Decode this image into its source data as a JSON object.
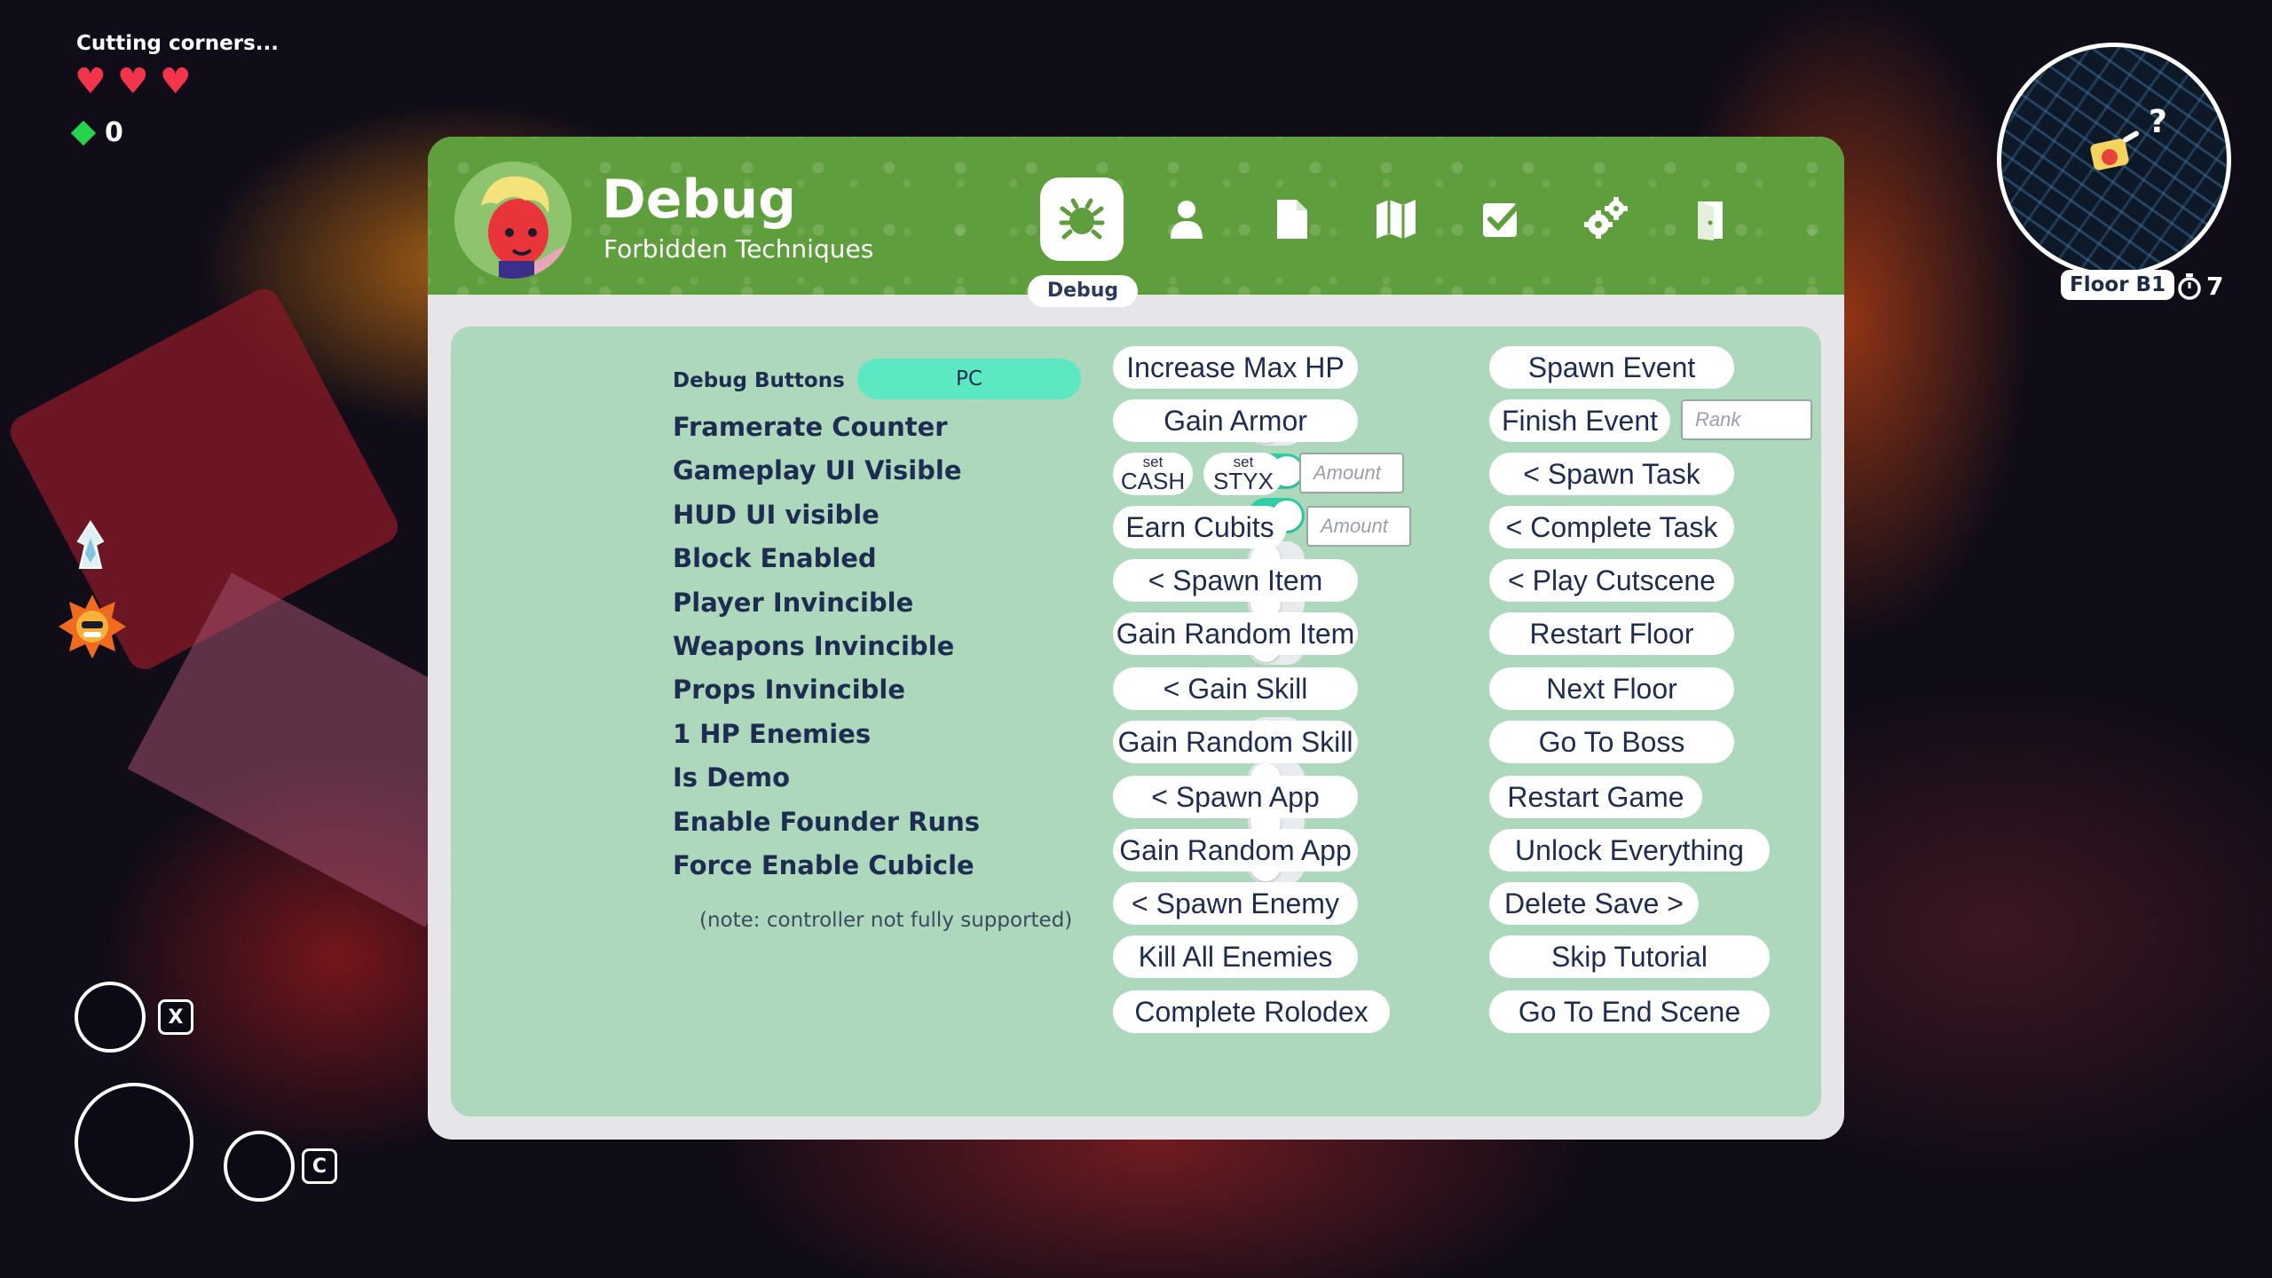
{
  "hud": {
    "status_text": "Cutting corners...",
    "hearts": 3,
    "gem_count": "0",
    "key_x": "X",
    "key_c": "C",
    "floor_label": "Floor B1",
    "timer_value": "7",
    "minimap_marker": "?"
  },
  "panel": {
    "title": "Debug",
    "subtitle": "Forbidden Techniques",
    "active_tab_label": "Debug",
    "tabs": [
      {
        "icon": "bug-icon",
        "active": true
      },
      {
        "icon": "person-icon",
        "active": false
      },
      {
        "icon": "document-icon",
        "active": false
      },
      {
        "icon": "map-icon",
        "active": false
      },
      {
        "icon": "checkbox-icon",
        "active": false
      },
      {
        "icon": "gears-icon",
        "active": false
      },
      {
        "icon": "exit-door-icon",
        "active": false
      }
    ]
  },
  "debug_buttons": {
    "label": "Debug Buttons",
    "mode": "PC"
  },
  "toggles": [
    {
      "label": "Framerate Counter",
      "on": false
    },
    {
      "label": "Gameplay UI Visible",
      "on": true
    },
    {
      "label": "HUD UI visible",
      "on": true
    },
    {
      "label": "Block Enabled",
      "on": false
    },
    {
      "label": "Player Invincible",
      "on": false
    },
    {
      "label": "Weapons Invincible",
      "on": false
    },
    {
      "label": "Props Invincible",
      "on": false
    },
    {
      "label": "1 HP Enemies",
      "on": false
    },
    {
      "label": "Is Demo",
      "on": false
    },
    {
      "label": "Enable Founder Runs",
      "on": false
    },
    {
      "label": "Force Enable Cubicle",
      "on": false
    }
  ],
  "note": "(note: controller not fully supported)",
  "col1": {
    "increase_max_hp": "Increase Max HP",
    "gain_armor": "Gain Armor",
    "set_cash_small": "set",
    "set_cash_big": "CASH",
    "set_styx_small": "set",
    "set_styx_big": "STYX",
    "amount_placeholder": "Amount",
    "earn_cubits": "Earn Cubits",
    "spawn_item": "< Spawn Item",
    "gain_random_item": "Gain Random Item",
    "gain_skill": "< Gain Skill",
    "gain_random_skill": "Gain Random Skill",
    "spawn_app": "< Spawn App",
    "gain_random_app": "Gain Random App",
    "spawn_enemy": "< Spawn Enemy",
    "kill_all_enemies": "Kill All Enemies",
    "complete_rolodex": "Complete Rolodex"
  },
  "col2": {
    "spawn_event": "Spawn Event",
    "finish_event": "Finish Event",
    "rank_placeholder": "Rank",
    "spawn_task": "< Spawn Task",
    "complete_task": "< Complete Task",
    "play_cutscene": "< Play Cutscene",
    "restart_floor": "Restart Floor",
    "next_floor": "Next Floor",
    "go_to_boss": "Go To Boss",
    "restart_game": "Restart Game",
    "unlock_everything": "Unlock Everything",
    "delete_save": "Delete Save >",
    "skip_tutorial": "Skip Tutorial",
    "go_to_end_scene": "Go To End Scene"
  },
  "colors": {
    "header_green": "#5f9e3c",
    "content_mint": "#aed8bb",
    "toggle_on": "#2ecfa6",
    "pc_pill": "#5de8c4",
    "text_navy": "#1e2c52",
    "heart_red": "#f3344a",
    "gem_green": "#24d44a"
  }
}
